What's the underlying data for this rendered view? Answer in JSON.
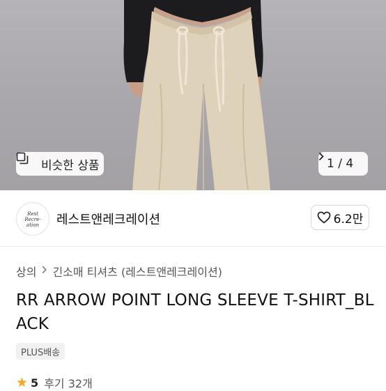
{
  "gallery": {
    "similar_label": "비슷한 상품",
    "similar_icon": "similar-items-icon",
    "pager": "1 / 4"
  },
  "seller": {
    "logo_text": "Rest Recreation",
    "name": "레스트앤레크레이션",
    "likes": "6.2만"
  },
  "breadcrumb": {
    "category": "상의",
    "subcategory": "긴소매 티셔츠 (레스트앤레크레이션)"
  },
  "product": {
    "title": "RR ARROW POINT LONG SLEEVE T-SHIRT_BLACK",
    "shipping_badge": "PLUS배송",
    "rating": "5",
    "reviews": "후기 32개"
  },
  "colors": {
    "accent_star": "#f5a623"
  }
}
